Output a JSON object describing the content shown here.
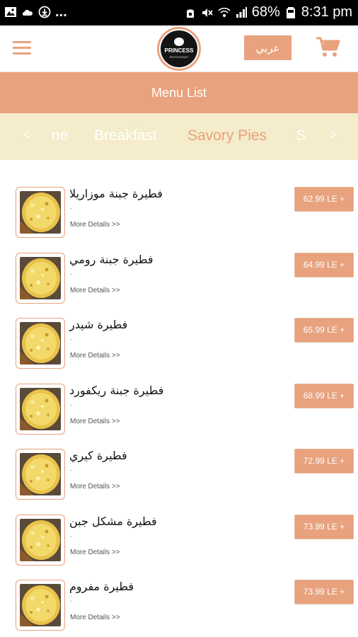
{
  "status_bar": {
    "battery": "68%",
    "time": "8:31 pm",
    "dots": "..."
  },
  "header": {
    "logo_text": "PRINCESS",
    "logo_subtext": "RESTAURANT",
    "language_button": "عربي",
    "accent_color": "#e8a27d"
  },
  "title_bar": {
    "title": "Menu List"
  },
  "categories": {
    "prev_arrow": "<",
    "next_arrow": ">",
    "partial_left": "ne",
    "tabs": [
      "Breakfast",
      "Savory Pies"
    ],
    "partial_right": "S",
    "active": "Savory Pies",
    "background_color": "#f4ecca"
  },
  "items": [
    {
      "name": "فطيرة جبنة موزاريلا",
      "dot": "-",
      "details": "More Details >>",
      "price": "62.99 LE +",
      "image": "cheese-pie-photo"
    },
    {
      "name": "فطيرة جبنة رومي",
      "dot": "-",
      "details": "More Details >>",
      "price": "64.99 LE +",
      "image": "cheese-pie-photo"
    },
    {
      "name": "فطيرة شيدر",
      "dot": "-",
      "details": "More Details >>",
      "price": "65.99 LE +",
      "image": "cheese-pie-photo"
    },
    {
      "name": "فطيرة جبنة ريكفورد",
      "dot": "-",
      "details": "More Details >>",
      "price": "68.99 LE +",
      "image": "cheese-pie-photo"
    },
    {
      "name": "فطيرة كيري",
      "dot": "-",
      "details": "More Details >>",
      "price": "72.99 LE +",
      "image": "cheese-pie-photo"
    },
    {
      "name": "فطيرة مشكل جبن",
      "dot": "-",
      "details": "More Details >>",
      "price": "73.99 LE +",
      "image": "cheese-pie-photo"
    },
    {
      "name": "فطيرة مفروم",
      "dot": "-",
      "details": "More Details >>",
      "price": "73.99 LE +",
      "image": "cheese-pie-photo"
    }
  ]
}
